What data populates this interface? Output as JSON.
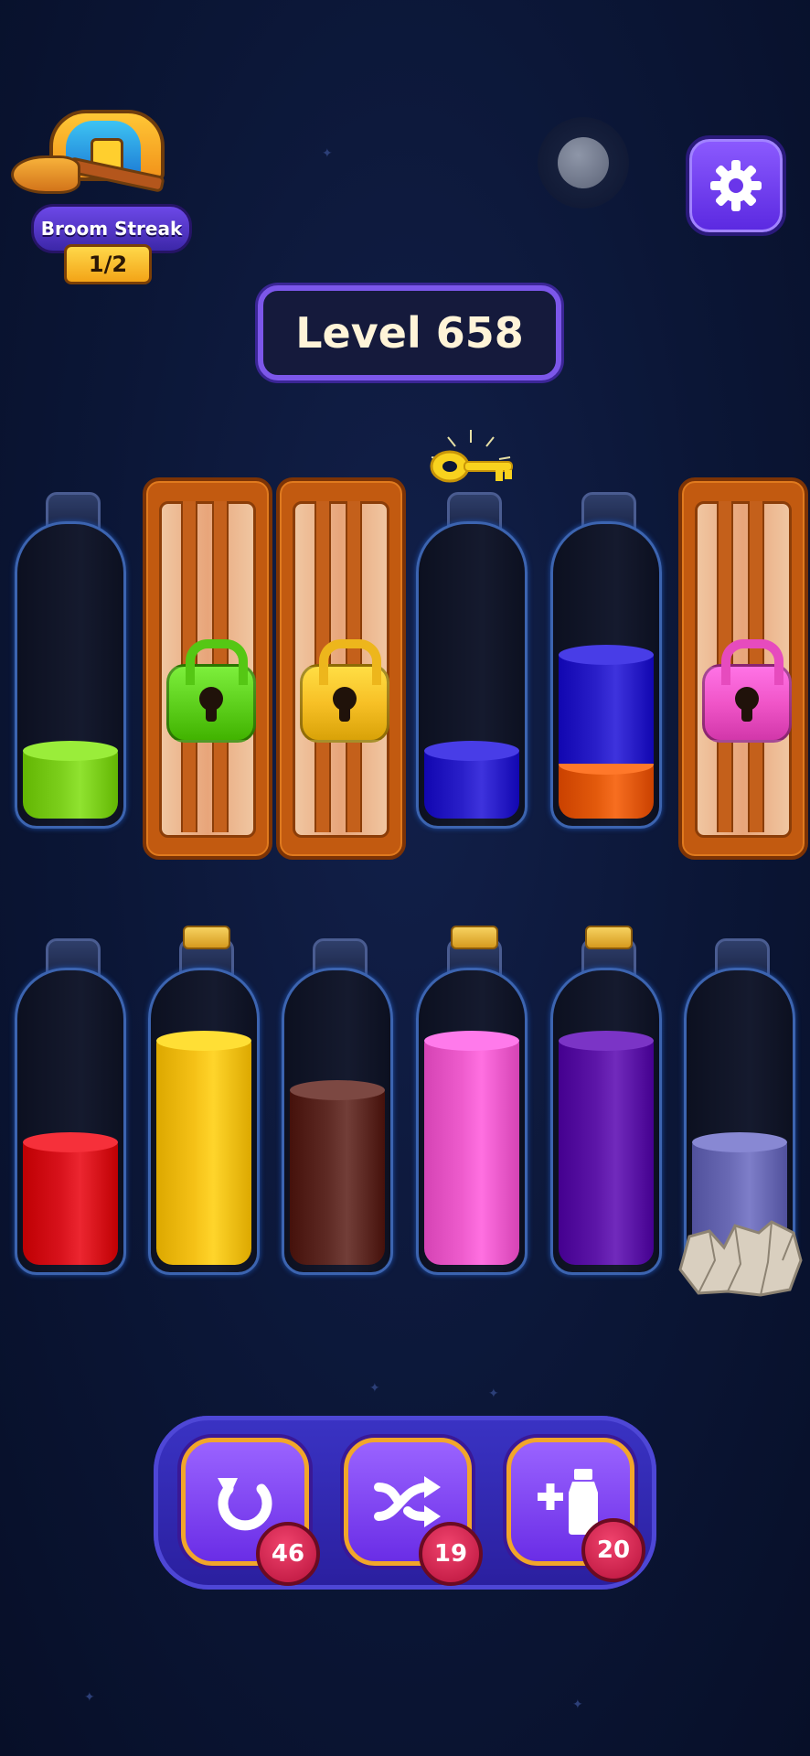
{
  "hud": {
    "streak_label": "Broom Streak",
    "streak_count": "1/2",
    "level_label": "Level 658"
  },
  "top_row": [
    {
      "type": "bottle",
      "layers": [
        {
          "color": "#7ccf1c",
          "fill": 0.25
        }
      ]
    },
    {
      "type": "locked",
      "lock_color": "green"
    },
    {
      "type": "locked",
      "lock_color": "yellow"
    },
    {
      "type": "bottle",
      "key_on_top": true,
      "layers": [
        {
          "color": "#2a1fc9",
          "fill": 0.25
        }
      ]
    },
    {
      "type": "bottle",
      "layers": [
        {
          "color": "#e35a0c",
          "fill": 0.2
        },
        {
          "color": "#2a1fc9",
          "fill": 0.4
        }
      ]
    },
    {
      "type": "locked",
      "lock_color": "pink"
    }
  ],
  "bottom_row": [
    {
      "type": "bottle",
      "layers": [
        {
          "color": "#d8121c",
          "fill": 0.45
        }
      ]
    },
    {
      "type": "bottle",
      "corked": true,
      "layers": [
        {
          "color": "#f5c117",
          "fill": 0.82
        }
      ]
    },
    {
      "type": "bottle",
      "layers": [
        {
          "color": "#5e2a24",
          "fill": 0.64
        }
      ]
    },
    {
      "type": "bottle",
      "corked": true,
      "layers": [
        {
          "color": "#ee5ccd",
          "fill": 0.82
        }
      ]
    },
    {
      "type": "bottle",
      "corked": true,
      "layers": [
        {
          "color": "#5d16a8",
          "fill": 0.82
        }
      ]
    },
    {
      "type": "bottle",
      "rocks": true,
      "layers": [
        {
          "color": "#6a6ab5",
          "fill": 0.45
        }
      ]
    }
  ],
  "lock_colors": {
    "green": "#5fd11e",
    "yellow": "#f7c026",
    "pink": "#f055c8"
  },
  "toolbar": {
    "undo_count": "46",
    "shuffle_count": "19",
    "add_bottle_count": "20"
  },
  "icons": {
    "settings": "gear-icon",
    "undo": "undo-icon",
    "shuffle": "shuffle-icon",
    "add_bottle": "add-bottle-icon",
    "chest": "treasure-chest-icon",
    "key": "key-icon"
  }
}
